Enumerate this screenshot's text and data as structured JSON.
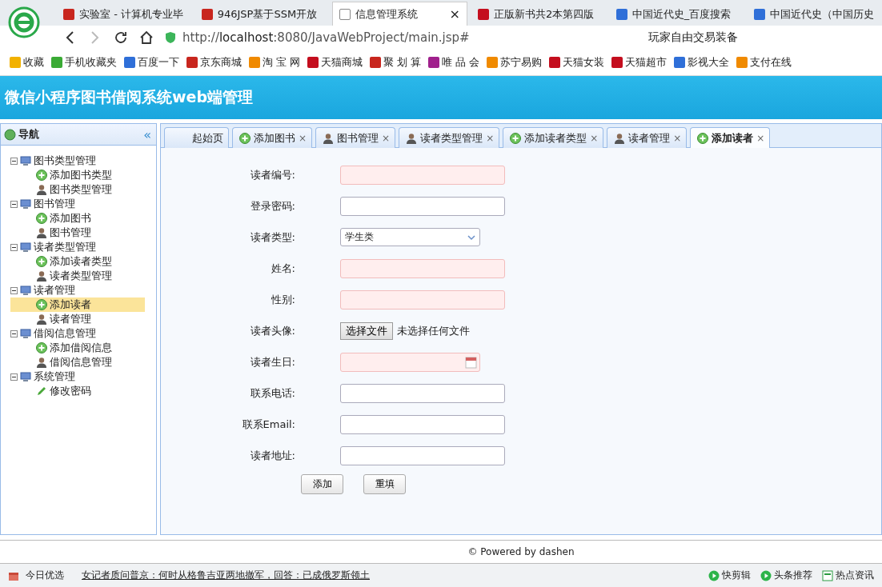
{
  "browser": {
    "tabs": [
      {
        "title": "实验室 - 计算机专业毕",
        "kind": "red",
        "selected": false
      },
      {
        "title": "946JSP基于SSM开放",
        "kind": "red",
        "selected": false
      },
      {
        "title": "信息管理系统",
        "kind": "doc",
        "selected": true,
        "close": "×"
      },
      {
        "title": "正版新书共2本第四版",
        "kind": "tmall",
        "selected": false
      },
      {
        "title": "中国近代史_百度搜索",
        "kind": "paw",
        "selected": false
      },
      {
        "title": "中国近代史（中国历史",
        "kind": "paw",
        "selected": false
      }
    ],
    "url_prefix": "http://",
    "url_host": "localhost",
    "url_rest": ":8080/JavaWebProject/main.jsp#",
    "search": "玩家自由交易装备",
    "bookmarks": [
      {
        "label": "收藏",
        "kind": "star"
      },
      {
        "label": "手机收藏夹",
        "kind": "phone"
      },
      {
        "label": "百度一下",
        "kind": "paw"
      },
      {
        "label": "京东商城",
        "kind": "red"
      },
      {
        "label": "淘 宝 网",
        "kind": "orange"
      },
      {
        "label": "天猫商城",
        "kind": "tmall"
      },
      {
        "label": "聚 划 算",
        "kind": "red"
      },
      {
        "label": "唯 品 会",
        "kind": "purple"
      },
      {
        "label": "苏宁易购",
        "kind": "orange"
      },
      {
        "label": "天猫女装",
        "kind": "tmall"
      },
      {
        "label": "天猫超市",
        "kind": "tmall"
      },
      {
        "label": "影视大全",
        "kind": "blue"
      },
      {
        "label": "支付在线",
        "kind": "orange"
      }
    ]
  },
  "app_title": "微信小程序图书借阅系统web端管理",
  "nav": {
    "title": "导航",
    "collapse": "«",
    "groups": [
      {
        "label": "图书类型管理",
        "expanded": true,
        "children": [
          {
            "label": "添加图书类型",
            "kind": "add",
            "selected": false
          },
          {
            "label": "图书类型管理",
            "kind": "user",
            "selected": false
          }
        ]
      },
      {
        "label": "图书管理",
        "expanded": true,
        "children": [
          {
            "label": "添加图书",
            "kind": "add",
            "selected": false
          },
          {
            "label": "图书管理",
            "kind": "user",
            "selected": false
          }
        ]
      },
      {
        "label": "读者类型管理",
        "expanded": true,
        "children": [
          {
            "label": "添加读者类型",
            "kind": "add",
            "selected": false
          },
          {
            "label": "读者类型管理",
            "kind": "user",
            "selected": false
          }
        ]
      },
      {
        "label": "读者管理",
        "expanded": true,
        "children": [
          {
            "label": "添加读者",
            "kind": "add",
            "selected": true
          },
          {
            "label": "读者管理",
            "kind": "user",
            "selected": false
          }
        ]
      },
      {
        "label": "借阅信息管理",
        "expanded": true,
        "children": [
          {
            "label": "添加借阅信息",
            "kind": "add",
            "selected": false
          },
          {
            "label": "借阅信息管理",
            "kind": "user",
            "selected": false
          }
        ]
      },
      {
        "label": "系统管理",
        "expanded": true,
        "children": [
          {
            "label": "修改密码",
            "kind": "edit",
            "selected": false
          }
        ]
      }
    ]
  },
  "content_tabs": [
    {
      "label": "起始页",
      "kind": "none",
      "selected": false
    },
    {
      "label": "添加图书",
      "kind": "add",
      "selected": false,
      "close": "×"
    },
    {
      "label": "图书管理",
      "kind": "user",
      "selected": false,
      "close": "×"
    },
    {
      "label": "读者类型管理",
      "kind": "user",
      "selected": false,
      "close": "×"
    },
    {
      "label": "添加读者类型",
      "kind": "add",
      "selected": false,
      "close": "×"
    },
    {
      "label": "读者管理",
      "kind": "user",
      "selected": false,
      "close": "×"
    },
    {
      "label": "添加读者",
      "kind": "add",
      "selected": true,
      "close": "×"
    }
  ],
  "form": {
    "fields": [
      {
        "label": "读者编号:",
        "kind": "text",
        "required": true
      },
      {
        "label": "登录密码:",
        "kind": "password",
        "required": false
      },
      {
        "label": "读者类型:",
        "kind": "select",
        "value": "学生类"
      },
      {
        "label": "姓名:",
        "kind": "text",
        "required": true
      },
      {
        "label": "性别:",
        "kind": "text",
        "required": true
      },
      {
        "label": "读者头像:",
        "kind": "file",
        "button": "选择文件",
        "status": "未选择任何文件"
      },
      {
        "label": "读者生日:",
        "kind": "date",
        "required": true
      },
      {
        "label": "联系电话:",
        "kind": "text",
        "required": false
      },
      {
        "label": "联系Email:",
        "kind": "text",
        "required": false
      },
      {
        "label": "读者地址:",
        "kind": "text",
        "required": false
      }
    ],
    "buttons": [
      "添加",
      "重填"
    ]
  },
  "footer": "© Powered by dashen",
  "status_bar": {
    "left": "今日优选",
    "news": "女记者质问普京：何时从格鲁吉亚两地撤军，回答：已成俄罗斯领土",
    "right": [
      {
        "label": "快剪辑",
        "kind": "play"
      },
      {
        "label": "头条推荐",
        "kind": "play"
      },
      {
        "label": "热点资讯",
        "kind": "news"
      }
    ]
  }
}
